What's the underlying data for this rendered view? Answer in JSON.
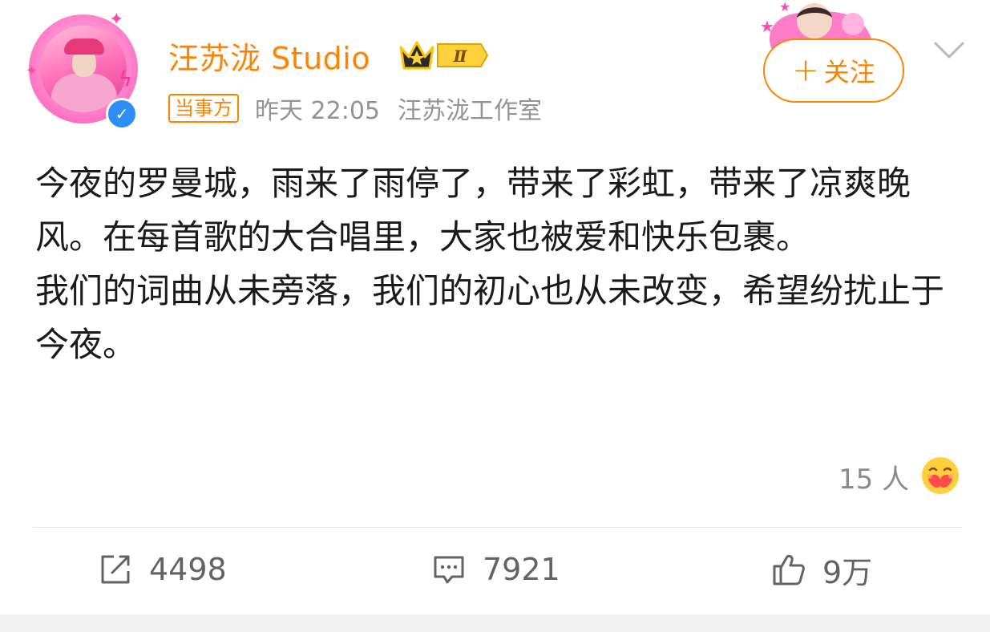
{
  "header": {
    "username": "汪苏泷 Studio",
    "party_tag": "当事方",
    "time": "昨天 22:05",
    "source": "汪苏泷工作室",
    "follow_label": "关注",
    "vip_level": "Ⅱ"
  },
  "post": {
    "paragraphs": [
      "今夜的罗曼城，雨来了雨停了，带来了彩虹，带来了凉爽晚风。在每首歌的大合唱里，大家也被爱和快乐包裹。",
      "我们的词曲从未旁落，我们的初心也从未改变，希望纷扰止于今夜。"
    ]
  },
  "reactions": {
    "count_label": "15 人",
    "emoji": "love-face-emoji"
  },
  "actions": {
    "repost_count": "4498",
    "comment_count": "7921",
    "like_count": "9万"
  },
  "colors": {
    "accent": "#ff8200",
    "verify": "#2b8ff5",
    "text": "#1a1a1a",
    "muted": "#939393"
  }
}
